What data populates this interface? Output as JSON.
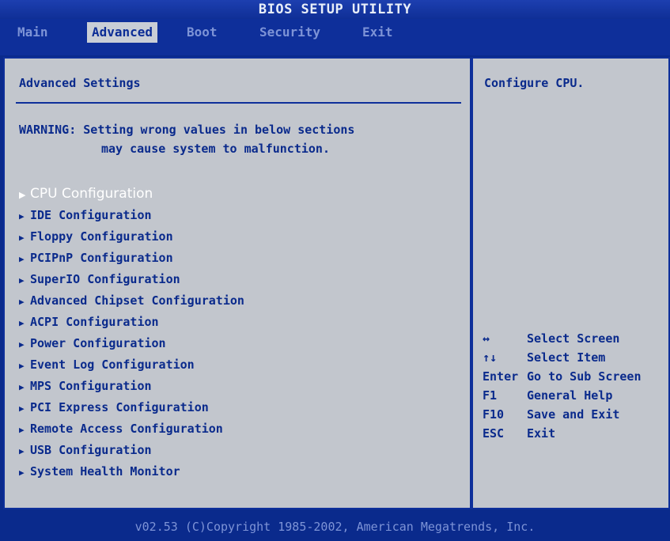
{
  "title": "BIOS SETUP UTILITY",
  "menu": [
    {
      "label": "Main"
    },
    {
      "label": "Advanced"
    },
    {
      "label": "Boot"
    },
    {
      "label": "Security"
    },
    {
      "label": "Exit"
    }
  ],
  "main": {
    "title": "Advanced Settings",
    "warning_line1": "WARNING: Setting wrong values in below sections",
    "warning_line2": "may cause system to malfunction.",
    "items": [
      {
        "label": "CPU Configuration"
      },
      {
        "label": "IDE Configuration"
      },
      {
        "label": "Floppy Configuration"
      },
      {
        "label": "PCIPnP Configuration"
      },
      {
        "label": "SuperIO Configuration"
      },
      {
        "label": "Advanced Chipset Configuration"
      },
      {
        "label": "ACPI Configuration"
      },
      {
        "label": "Power Configuration"
      },
      {
        "label": "Event Log Configuration"
      },
      {
        "label": "MPS Configuration"
      },
      {
        "label": "PCI Express Configuration"
      },
      {
        "label": "Remote Access Configuration"
      },
      {
        "label": "USB Configuration"
      },
      {
        "label": "System Health Monitor"
      }
    ],
    "selected_index": 0
  },
  "help": {
    "text": "Configure CPU.",
    "keys": [
      {
        "key": "↔",
        "action": "Select Screen"
      },
      {
        "key": "↑↓",
        "action": "Select Item"
      },
      {
        "key": "Enter",
        "action": "Go to Sub Screen"
      },
      {
        "key": "F1",
        "action": "General Help"
      },
      {
        "key": "F10",
        "action": "Save and Exit"
      },
      {
        "key": "ESC",
        "action": "Exit"
      }
    ]
  },
  "footer": "v02.53 (C)Copyright 1985-2002, American Megatrends, Inc.",
  "arrow_icon": "triangle-right-icon",
  "colors": {
    "background": "#0a2a8c",
    "panel": "#c2c6cd",
    "text": "#0a2a8c",
    "selected_text": "#ffffff",
    "inactive_menu": "#7d93d6"
  }
}
